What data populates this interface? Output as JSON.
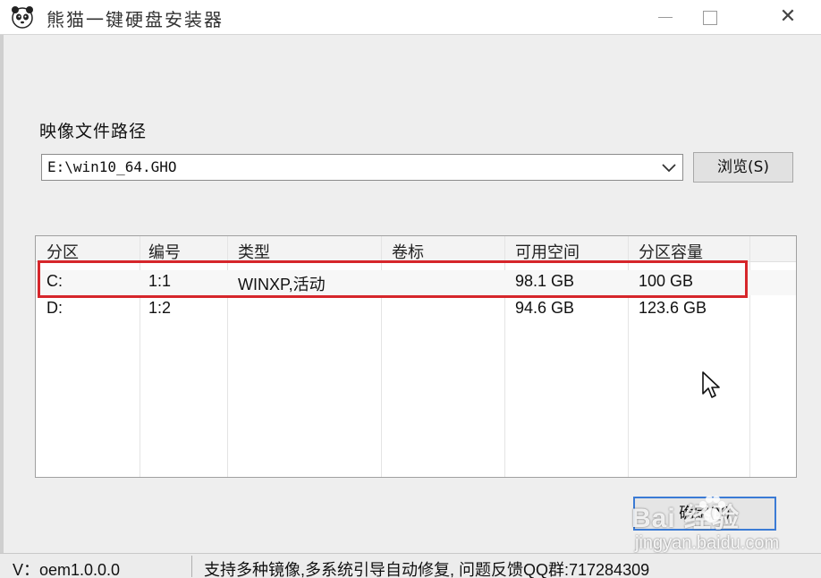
{
  "window": {
    "title": "熊猫一键硬盘安装器",
    "icon": "panda-icon",
    "controls": {
      "minimize_icon": "minimize-icon",
      "maximize_icon": "maximize-icon",
      "close_label": "✕"
    }
  },
  "image_path": {
    "label": "映像文件路径",
    "value": "E:\\win10_64.GHO",
    "browse_label": "浏览(S)"
  },
  "partition_table": {
    "columns": [
      "分区",
      "编号",
      "类型",
      "卷标",
      "可用空间",
      "分区容量"
    ],
    "rows": [
      {
        "partition": "C:",
        "number": "1:1",
        "type": "WINXP,活动",
        "label": "",
        "free": "98.1 GB",
        "capacity": "100 GB",
        "selected": true
      },
      {
        "partition": "D:",
        "number": "1:2",
        "type": "",
        "label": "",
        "free": "94.6 GB",
        "capacity": "123.6 GB",
        "selected": false
      }
    ]
  },
  "ok_button": {
    "label": "确定(Y)"
  },
  "watermark": {
    "logo": "Bai 经验",
    "url": "jingyan.baidu.com"
  },
  "status_bar": {
    "version": "V：oem1.0.0.0",
    "info": "支持多种镜像,多系统引导自动修复, 问题反馈QQ群:717284309"
  },
  "colors": {
    "highlight": "#d6262b",
    "ok_border": "#3b7bd5"
  }
}
